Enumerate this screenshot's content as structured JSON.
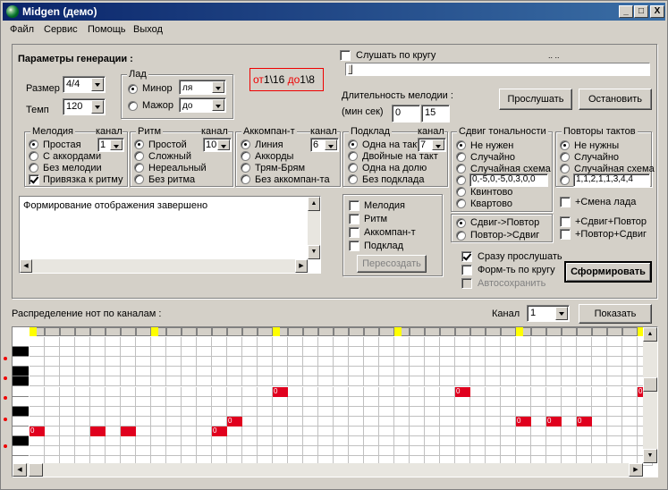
{
  "window": {
    "title": "Midgen (демо)",
    "min": "_",
    "max": "□",
    "close": "X"
  },
  "menu": [
    "Файл",
    "Сервис",
    "Помощь",
    "Выход"
  ],
  "params": {
    "title": "Параметры генерации :",
    "size_label": "Размер",
    "size_value": "4/4",
    "tempo_label": "Темп",
    "tempo_value": "120",
    "lad_title": "Лад",
    "minor_label": "Минор",
    "major_label": "Мажор",
    "minor_value": "ля",
    "major_value": "до",
    "range_from": "от",
    "range_a": "1\\16",
    "range_to": "до",
    "range_b": "1\\8",
    "loop_label": "Слушать по кругу",
    "loop_ticks": ".. ..",
    "duration_label": "Длительность мелодии :",
    "duration_unit": "(мин сек)",
    "duration_min": "0",
    "duration_sec": "15",
    "listen_button": "Прослушать",
    "stop_button": "Остановить"
  },
  "melody": {
    "title": "Мелодия",
    "channel_label": "канал",
    "channel_value": "1",
    "options": [
      "Простая",
      "С аккордами",
      "Без мелодии"
    ],
    "rhythm_bind": "Привязка к ритму"
  },
  "rhythm": {
    "title": "Ритм",
    "channel_label": "канал",
    "channel_value": "10",
    "options": [
      "Простой",
      "Сложный",
      "Нереальный",
      "Без ритма"
    ]
  },
  "accomp": {
    "title": "Аккомпан-т",
    "channel_label": "канал",
    "channel_value": "6",
    "options": [
      "Линия",
      "Аккорды",
      "Трям-Брям",
      "Без аккомпан-та"
    ]
  },
  "pad": {
    "title": "Подклад",
    "channel_label": "канал",
    "channel_value": "7",
    "options": [
      "Одна на такт",
      "Двойные на такт",
      "Одна на долю",
      "Без подклада"
    ]
  },
  "shift": {
    "title": "Сдвиг тональности",
    "options": [
      "Не нужен",
      "Случайно",
      "Случайная схема"
    ],
    "scheme": "0,-5,0,-5,0,3,0,0",
    "quint": "Квинтово",
    "quart": "Квартово",
    "order": [
      "Сдвиг->Повтор",
      "Повтор->Сдвиг"
    ]
  },
  "repeats": {
    "title": "Повторы тактов",
    "options": [
      "Не нужны",
      "Случайно",
      "Случайная схема"
    ],
    "scheme": "1,1,2,1,1,3,4,4",
    "checks": [
      "+Смена лада",
      "+Сдвиг+Повтор",
      "+Повтор+Сдвиг"
    ]
  },
  "log": {
    "text": "Формирование отображения завершено"
  },
  "regen": {
    "checks": [
      "Мелодия",
      "Ритм",
      "Аккомпан-т",
      "Подклад"
    ],
    "button": "Пересоздать"
  },
  "options": {
    "listen_now": "Сразу прослушать",
    "loop_form": "Форм-ть по кругу",
    "autosave": "Автосохранить",
    "form_button": "Сформировать"
  },
  "distribution": {
    "label": "Распределение нот по каналам :",
    "channel_label": "Канал",
    "channel_value": "1",
    "show_button": "Показать"
  },
  "grid": {
    "bars": [
      "1",
      "2",
      "3",
      "4",
      "5",
      "5"
    ],
    "rows": [
      "83",
      "",
      "81",
      "",
      "",
      "",
      "77",
      "76",
      "",
      "74",
      "",
      "72",
      "71"
    ],
    "notes": [
      {
        "row": 9,
        "col": 0,
        "txt": "0"
      },
      {
        "row": 9,
        "col": 4,
        "txt": ""
      },
      {
        "row": 9,
        "col": 6,
        "txt": ""
      },
      {
        "row": 9,
        "col": 12,
        "txt": "0"
      },
      {
        "row": 8,
        "col": 13,
        "txt": "0"
      },
      {
        "row": 5,
        "col": 16,
        "txt": "0"
      },
      {
        "row": 5,
        "col": 28,
        "txt": "0"
      },
      {
        "row": 8,
        "col": 32,
        "txt": "0"
      },
      {
        "row": 8,
        "col": 34,
        "txt": "0"
      },
      {
        "row": 8,
        "col": 36,
        "txt": "0"
      },
      {
        "row": 5,
        "col": 40,
        "txt": "0"
      }
    ]
  }
}
